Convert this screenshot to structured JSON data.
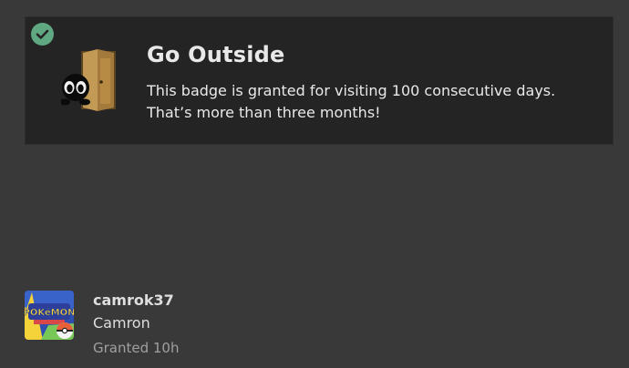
{
  "badge": {
    "title": "Go Outside",
    "description_line1": "This badge is granted for visiting 100 consecutive days.",
    "description_line2": "That’s more than three months!",
    "granted_icon": "check-icon",
    "image_icon": "door-with-creature-icon"
  },
  "grant": {
    "username": "camrok37",
    "display_name": "Camron",
    "granted_text": "Granted 10h",
    "avatar_icon": "pokemon-avatar-icon"
  },
  "colors": {
    "background": "#393939",
    "card": "#242424",
    "check": "#5fa882",
    "text": "#e9e9e9",
    "muted": "#a0a0a0"
  }
}
